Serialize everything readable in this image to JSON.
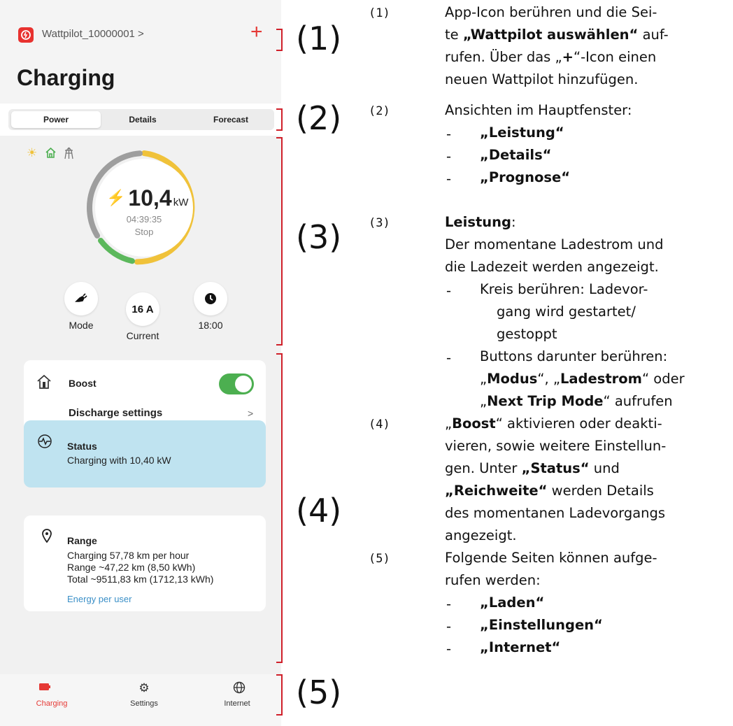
{
  "phone": {
    "wallbox_name": "Wattpilot_10000001 >",
    "add_icon": "+",
    "page_title": "Charging",
    "tabs": [
      "Power",
      "Details",
      "Forecast"
    ],
    "active_tab": "Power",
    "power_value": "10,4",
    "power_unit": "kW",
    "timer": "04:39:35",
    "stop_label": "Stop",
    "current_value": "16 A",
    "buttons": {
      "mode": "Mode",
      "current": "Current",
      "time": "18:00"
    },
    "boost_title": "Boost",
    "boost_enabled": true,
    "discharge_settings": "Discharge settings",
    "chevron": ">",
    "status_title": "Status",
    "status_text": "Charging with 10,40 kW",
    "range_title": "Range",
    "range_line1": "Charging 57,78 km per hour",
    "range_line2": "Range ~47,22 km (8,50 kWh)",
    "range_line3": "Total ~9511,83 km (1712,13 kWh)",
    "energy_link": "Energy per user",
    "nav": [
      "Charging",
      "Settings",
      "Internet"
    ],
    "colors": {
      "accent": "#e53935",
      "ring_yellow": "#f0c23a",
      "ring_green": "#5cb85c",
      "ring_gray": "#9e9e9e",
      "toggle": "#4caf50",
      "status_bg": "#bfe3f0",
      "link": "#3a8fc7"
    }
  },
  "callouts": [
    "(1)",
    "(2)",
    "(3)",
    "(4)",
    "(5)"
  ],
  "annotations": {
    "n1": "(1)",
    "a1_l1": "App-Icon berühren und die Sei-",
    "a1_l2a": "te ",
    "a1_l2b": "„Wattpilot auswählen“",
    "a1_l2c": " auf-",
    "a1_l3a": "rufen. Über das „",
    "a1_l3b": "+",
    "a1_l3c": "“-Icon einen",
    "a1_l4": "neuen Wattpilot hinzufügen.",
    "n2": "(2)",
    "a2_l1": "Ansichten im Hauptfenster:",
    "a2_i1": "„Leistung“",
    "a2_i2": "„Details“",
    "a2_i3": "„Prognose“",
    "n3": "(3)",
    "a3_title": "Leistung",
    "a3_colon": ":",
    "a3_l1": "Der momentane Ladestrom und",
    "a3_l2": "die Ladezeit werden angezeigt.",
    "a3_b1_l1": "Kreis berühren: Ladevor-",
    "a3_b1_l2": "gang wird gestartet/",
    "a3_b1_l3": "gestoppt",
    "a3_b2_l1": "Buttons darunter berühren:",
    "a3_b2_l2a": "„",
    "a3_b2_l2b": "Modus",
    "a3_b2_l2c": "“, „",
    "a3_b2_l2d": "Ladestrom",
    "a3_b2_l2e": "“ oder",
    "a3_b2_l3a": "„",
    "a3_b2_l3b": "Next Trip Mode",
    "a3_b2_l3c": "“ aufrufen",
    "n4": "(4)",
    "a4_l1a": "„",
    "a4_l1b": "Boost",
    "a4_l1c": "“ aktivieren oder deakti-",
    "a4_l2": "vieren, sowie weitere Einstellun-",
    "a4_l3a": "gen. Unter ",
    "a4_l3b": "„Status“",
    "a4_l3c": " und",
    "a4_l4a": "„Reichweite“",
    "a4_l4b": " werden Details",
    "a4_l5": "des momentanen Ladevorgangs",
    "a4_l6": "angezeigt.",
    "n5": "(5)",
    "a5_l1": "Folgende Seiten können aufge-",
    "a5_l2": "rufen werden:",
    "a5_i1": "„Laden“",
    "a5_i2": "„Einstellungen“",
    "a5_i3": "„Internet“",
    "dash": "-"
  }
}
